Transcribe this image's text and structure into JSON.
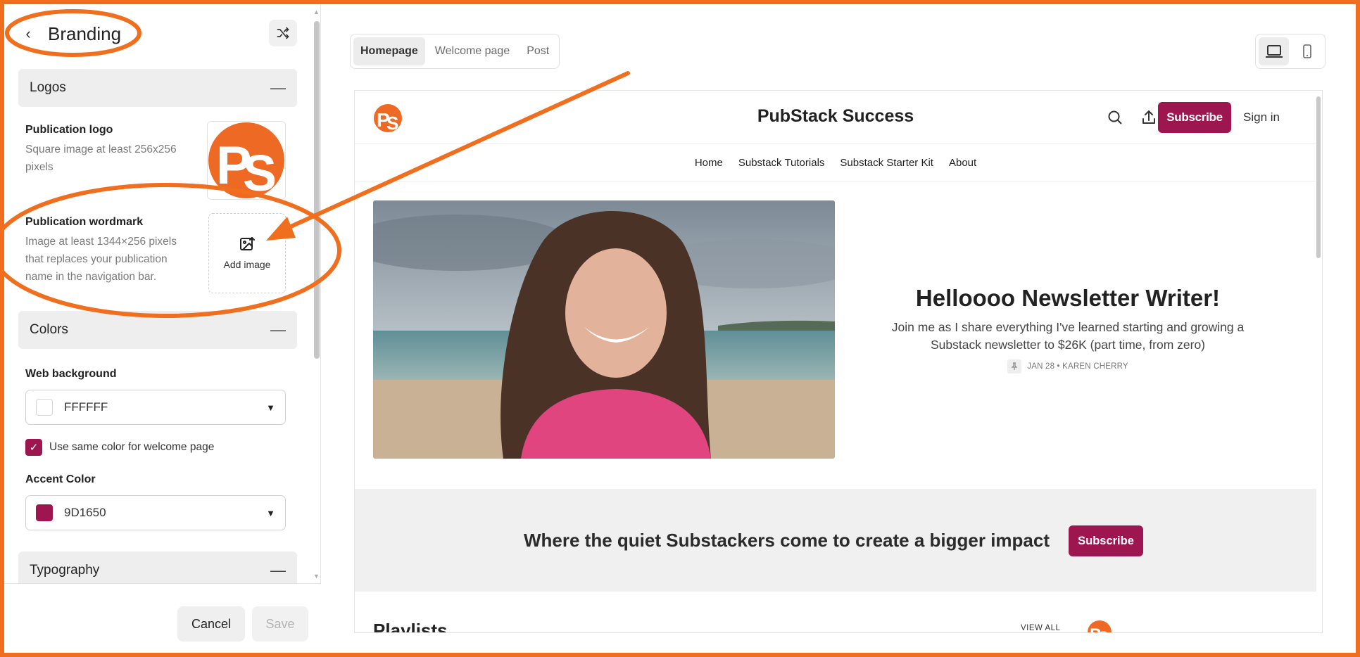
{
  "panel": {
    "title": "Branding",
    "sections": {
      "logos": "Logos",
      "colors": "Colors",
      "typography": "Typography"
    },
    "publication_logo": {
      "title": "Publication logo",
      "desc": "Square image at least 256x256 pixels"
    },
    "publication_wordmark": {
      "title": "Publication wordmark",
      "desc": "Image at least 1344×256 pixels that replaces your publication name in the navigation bar.",
      "add_image": "Add image"
    },
    "web_background": {
      "label": "Web background",
      "value": "FFFFFF",
      "swatch": "#FFFFFF"
    },
    "same_color_checkbox": {
      "label": "Use same color for welcome page",
      "checked": true
    },
    "accent_color": {
      "label": "Accent Color",
      "value": "9D1650",
      "swatch": "#9D1650"
    },
    "footer": {
      "cancel": "Cancel",
      "save": "Save"
    }
  },
  "preview": {
    "tabs": [
      "Homepage",
      "Welcome page",
      "Post"
    ],
    "active_tab": "Homepage",
    "device_active": "desktop-icon",
    "site": {
      "title": "PubStack Success",
      "subscribe": "Subscribe",
      "sign_in": "Sign in",
      "nav": [
        "Home",
        "Substack Tutorials",
        "Substack Starter Kit",
        "About"
      ],
      "hero": {
        "title": "Helloooo Newsletter Writer!",
        "subtitle": "Join me as I share everything I've learned starting and growing a Substack newsletter to $26K (part time, from zero)",
        "meta": "JAN 28 • KAREN CHERRY"
      },
      "banner": {
        "text": "Where the quiet Substackers come to create a bigger impact",
        "button": "Subscribe"
      },
      "playlists": "Playlists",
      "view_all": "VIEW ALL"
    }
  },
  "colors": {
    "accent": "#9D1650",
    "annotation": "#F06F1E",
    "logo_orange": "#EE6A24"
  }
}
